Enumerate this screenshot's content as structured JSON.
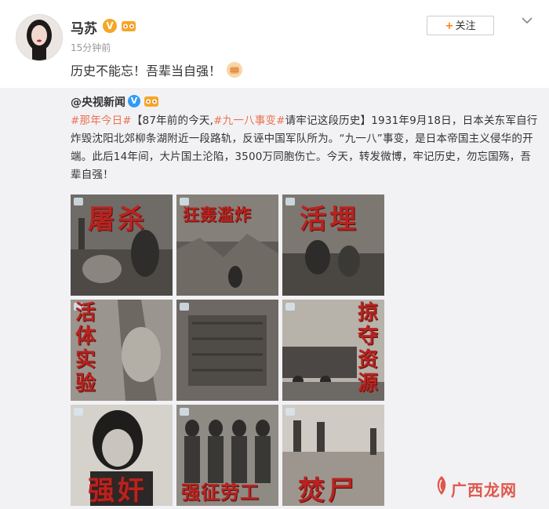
{
  "post": {
    "username": "马苏",
    "verified_badge": "V",
    "timestamp": "15分钟前",
    "text": "历史不能忘！吾辈当自强！",
    "follow_label": "关注",
    "follow_plus": "+"
  },
  "repost": {
    "author_at": "@",
    "author_name": "央视新闻",
    "verified_badge": "V",
    "hashtag1": "#那年今日#",
    "hashtag2": "#九一八事变#",
    "text_part1": "【87年前的今天,",
    "text_part2": "请牢记这段历史】1931年9月18日，日本关东军自行炸毁沈阳北郊柳条湖附近一段路轨，反诬中国军队所为。“九一八”事变，是日本帝国主义侵华的开端。此后14年间，大片国土沦陷，3500万同胞伤亡。今天，转发微博，牢记历史，勿忘国殇，吾辈自强！"
  },
  "images": [
    {
      "caption": "屠杀",
      "orientation": "horizontal"
    },
    {
      "caption": "狂轰滥炸",
      "orientation": "horizontal"
    },
    {
      "caption": "活埋",
      "orientation": "horizontal"
    },
    {
      "caption": "活体实验",
      "orientation": "vertical"
    },
    {
      "caption": "",
      "orientation": "center"
    },
    {
      "caption": "掠夺资源",
      "orientation": "vertical"
    },
    {
      "caption": "强奸",
      "orientation": "horizontal"
    },
    {
      "caption": "强征劳工",
      "orientation": "horizontal"
    },
    {
      "caption": "焚尸",
      "orientation": "horizontal"
    }
  ],
  "watermark": "广西龙网",
  "colors": {
    "accent": "#ff8200",
    "hashtag": "#eb7350",
    "caption_red": "#b8231f",
    "repost_bg": "#f2f2f5"
  }
}
